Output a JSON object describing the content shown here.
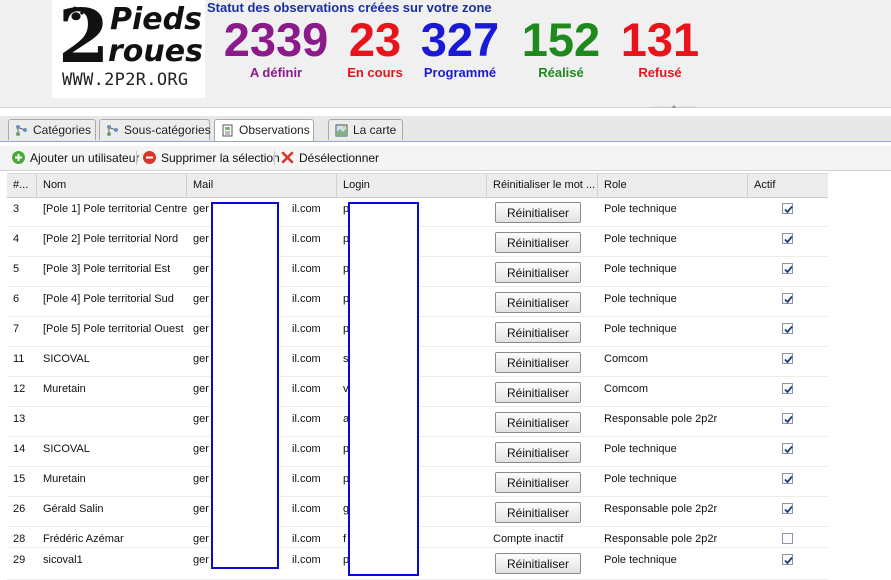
{
  "logo": {
    "numeral": "2",
    "word1": "Pieds",
    "word2": "roues",
    "url": "WWW.2P2R.ORG"
  },
  "stats": {
    "title": "Statut des observations créées sur votre zone",
    "items": [
      {
        "value": "2339",
        "label": "A définir",
        "color": "#8b1a8b"
      },
      {
        "value": "23",
        "label": "En cours",
        "color": "#e8141c"
      },
      {
        "value": "327",
        "label": "Programmé",
        "color": "#1a1ad6"
      },
      {
        "value": "152",
        "label": "Réalisé",
        "color": "#1e8a1e"
      },
      {
        "value": "131",
        "label": "Refusé",
        "color": "#e8141c"
      }
    ]
  },
  "tabs": [
    {
      "label": "Catégories",
      "icon": "category-tree-icon"
    },
    {
      "label": "Sous-catégories",
      "icon": "subcategory-tree-icon"
    },
    {
      "label": "Observations",
      "icon": "observations-icon"
    },
    {
      "label": "La carte",
      "icon": "map-icon"
    }
  ],
  "toolbar": {
    "add_label": "Ajouter un utilisateur",
    "delete_label": "Supprimer la sélection",
    "deselect_label": "Désélectionner"
  },
  "grid": {
    "columns": [
      "#...",
      "Nom",
      "Mail",
      "Login",
      "Réinitialiser le mot ...",
      "Role",
      "Actif"
    ],
    "reset_label": "Réinitialiser",
    "rows": [
      {
        "id": "3",
        "nom": "[Pole 1] Pole territorial Centre",
        "mail": "ger",
        "mail_end": "il.com",
        "login": "p",
        "reset": "button",
        "role": "Pole technique",
        "actif": true
      },
      {
        "id": "4",
        "nom": "[Pole 2] Pole territorial Nord",
        "mail": "ger",
        "mail_end": "il.com",
        "login": "p",
        "reset": "button",
        "role": "Pole technique",
        "actif": true
      },
      {
        "id": "5",
        "nom": "[Pole 3] Pole territorial Est",
        "mail": "ger",
        "mail_end": "il.com",
        "login": "p",
        "reset": "button",
        "role": "Pole technique",
        "actif": true
      },
      {
        "id": "6",
        "nom": "[Pole 4] Pole territorial Sud",
        "mail": "ger",
        "mail_end": "il.com",
        "login": "p",
        "reset": "button",
        "role": "Pole technique",
        "actif": true
      },
      {
        "id": "7",
        "nom": "[Pole 5] Pole territorial Ouest",
        "mail": "ger",
        "mail_end": "il.com",
        "login": "p",
        "reset": "button",
        "role": "Pole technique",
        "actif": true
      },
      {
        "id": "11",
        "nom": "SICOVAL",
        "mail": "ger",
        "mail_end": "il.com",
        "login": "s",
        "reset": "button",
        "role": "Comcom",
        "actif": true
      },
      {
        "id": "12",
        "nom": "Muretain",
        "mail": "ger",
        "mail_end": "il.com",
        "login": "v",
        "reset": "button",
        "role": "Comcom",
        "actif": true
      },
      {
        "id": "13",
        "nom": "",
        "mail": "ger",
        "mail_end": "il.com",
        "login": "a",
        "reset": "button",
        "role": "Responsable pole 2p2r",
        "actif": true
      },
      {
        "id": "14",
        "nom": "SICOVAL",
        "mail": "ger",
        "mail_end": "il.com",
        "login": "p",
        "reset": "button",
        "role": "Pole technique",
        "actif": true
      },
      {
        "id": "15",
        "nom": "Muretain",
        "mail": "ger",
        "mail_end": "il.com",
        "login": "p",
        "reset": "button",
        "role": "Pole technique",
        "actif": true
      },
      {
        "id": "26",
        "nom": "Gérald Salin",
        "mail": "ger",
        "mail_end": "il.com",
        "login": "g",
        "reset": "button",
        "role": "Responsable pole 2p2r",
        "actif": true
      },
      {
        "id": "28",
        "nom": "Frédéric Azémar",
        "mail": "ger",
        "mail_end": "il.com",
        "login": "f",
        "reset": "Compte inactif",
        "role": "Responsable pole 2p2r",
        "actif": false
      },
      {
        "id": "29",
        "nom": "sicoval1",
        "mail": "ger",
        "mail_end": "il.com",
        "login": "p",
        "reset": "button",
        "role": "Pole technique",
        "actif": true
      }
    ]
  }
}
